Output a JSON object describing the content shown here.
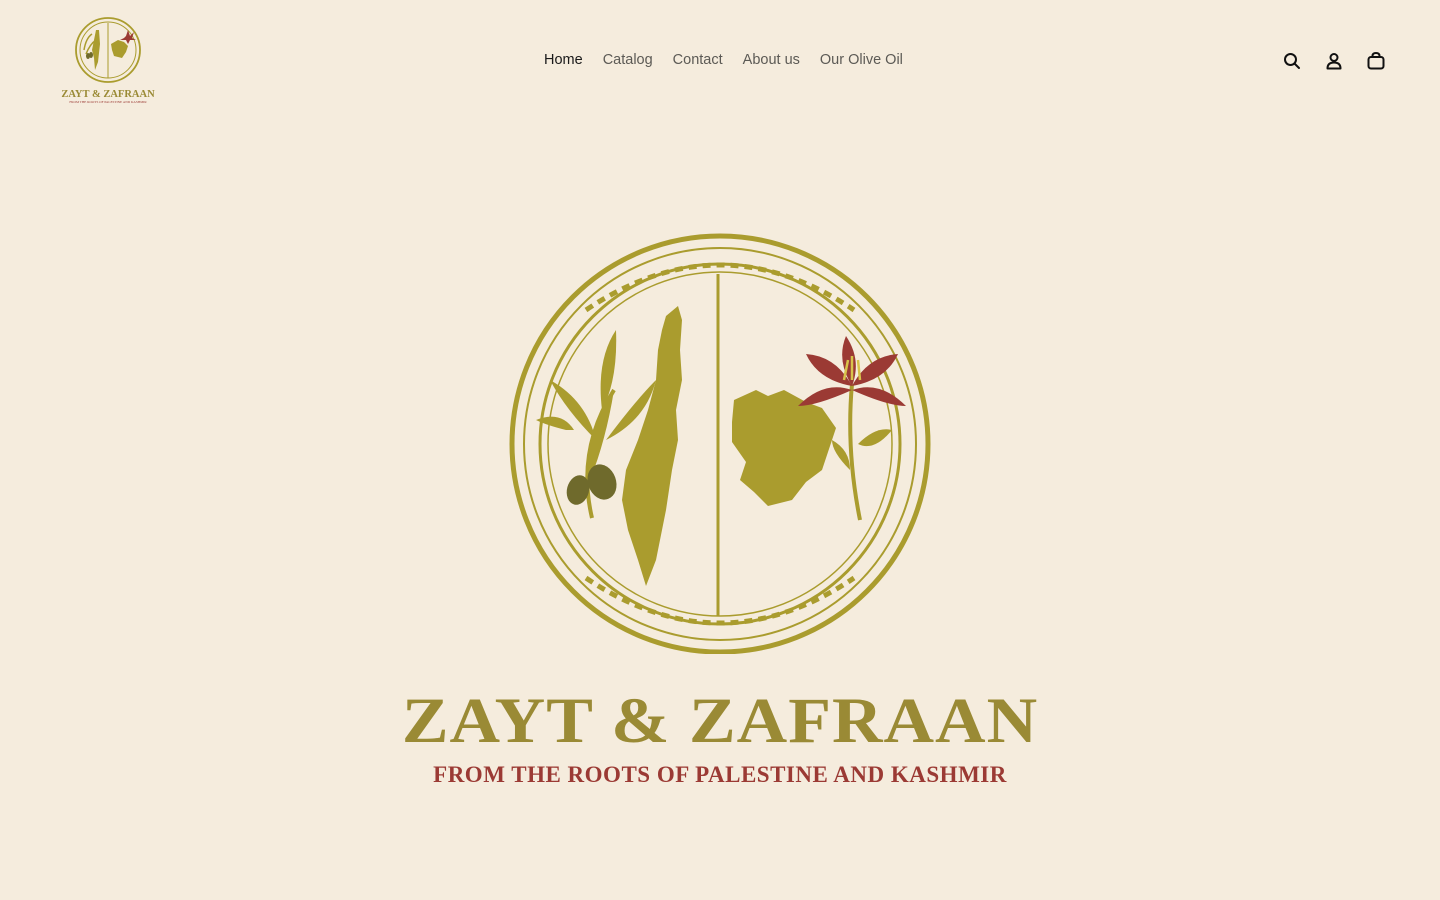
{
  "brand": {
    "name": "ZAYT & ZAFRAAN",
    "tagline": "FROM THE ROOTS OF PALESTINE AND KASHMIR"
  },
  "nav": {
    "items": [
      {
        "label": "Home",
        "active": true
      },
      {
        "label": "Catalog",
        "active": false
      },
      {
        "label": "Contact",
        "active": false
      },
      {
        "label": "About us",
        "active": false
      },
      {
        "label": "Our Olive Oil",
        "active": false
      }
    ]
  },
  "header_icons": [
    "search-icon",
    "account-icon",
    "cart-icon"
  ],
  "colors": {
    "background": "#f5ecdd",
    "olive_gold": "#aa9c2e",
    "dark_olive": "#6f6a2c",
    "saffron_red": "#9b3a34",
    "nav_text": "#5c5a55",
    "nav_active": "#1a1a1a"
  }
}
